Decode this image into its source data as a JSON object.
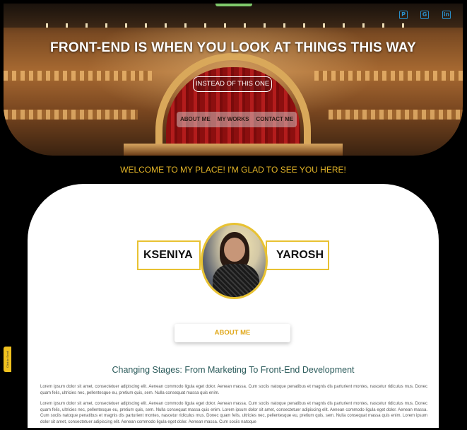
{
  "hero": {
    "title": "FRONT-END IS WHEN YOU LOOK AT THINGS THIS WAY",
    "subtitle_pill": "INSTEAD OF THIS ONE"
  },
  "social": {
    "icons": [
      "pinterest-icon",
      "github-icon",
      "linkedin-icon"
    ],
    "glyphs": [
      "P",
      "G",
      "in"
    ]
  },
  "nav": {
    "items": [
      "ABOUT ME",
      "MY WORKS",
      "CONTACT ME"
    ]
  },
  "welcome": "WELCOME TO MY PLACE! I'M GLAD TO SEE YOU HERE!",
  "profile": {
    "first_name": "KSENIYA",
    "last_name": "YAROSH"
  },
  "about_button": "ABOUT ME",
  "section_title": "Changing Stages: From Marketing To Front-End Development",
  "paragraphs": [
    "Lorem ipsum dolor sit amet, consectetuer adipiscing elit. Aenean commodo ligula eget dolor. Aenean massa. Cum sociis natoque penatibus et magnis dis parturient montes, nascetur ridiculus mus. Donec quam felis, ultricies nec, pellentesque eu, pretium quis, sem. Nulla consequat massa quis enim.",
    "Lorem ipsum dolor sit amet, consectetuer adipiscing elit. Aenean commodo ligula eget dolor. Aenean massa. Cum sociis natoque penatibus et magnis dis parturient montes, nascetur ridiculus mus. Donec quam felis, ultricies nec, pellentesque eu, pretium quis, sem. Nulla consequat massa quis enim. Lorem ipsum dolor sit amet, consectetuer adipiscing elit. Aenean commodo ligula eget dolor. Aenean massa. Cum sociis natoque penatibus et magnis dis parturient montes, nascetur ridiculus mus. Donec quam felis, ultricies nec, pellentesque eu, pretium quis, sem. Nulla consequat massa quis enim. Lorem ipsum dolor sit amet, consectetuer adipiscing elit. Aenean commodo ligula eget dolor. Aenean massa. Cum sociis natoque"
  ],
  "side_tab": "Click to Scroll",
  "colors": {
    "accent_yellow": "#e8c232",
    "welcome_yellow": "#e2b428",
    "social_blue": "#2a8ec8",
    "title_teal": "#2a5a5a"
  }
}
